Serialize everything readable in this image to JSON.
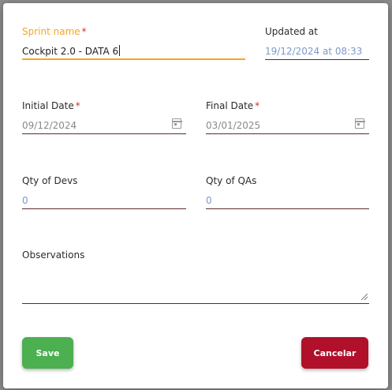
{
  "dialog": {
    "sprint_name": {
      "label": "Sprint name",
      "required_mark": "*",
      "value": "Cockpit 2.0 - DATA 6"
    },
    "updated_at": {
      "label": "Updated at",
      "value": "19/12/2024 at 08:33"
    },
    "initial_date": {
      "label": "Initial Date",
      "required_mark": "*",
      "value": "09/12/2024",
      "icon": "calendar-icon"
    },
    "final_date": {
      "label": "Final Date",
      "required_mark": "*",
      "value": "03/01/2025",
      "icon": "calendar-icon"
    },
    "qty_devs": {
      "label": "Qty of Devs",
      "value": "0"
    },
    "qty_qas": {
      "label": "Qty of QAs",
      "value": "0"
    },
    "observations": {
      "label": "Observations",
      "value": ""
    },
    "buttons": {
      "save": "Save",
      "cancel": "Cancelar"
    }
  },
  "colors": {
    "focus_accent": "#f5a623",
    "required": "#d32f2f",
    "save_button": "#4caf50",
    "cancel_button": "#b0102a",
    "readonly_value": "#7f99c8"
  }
}
